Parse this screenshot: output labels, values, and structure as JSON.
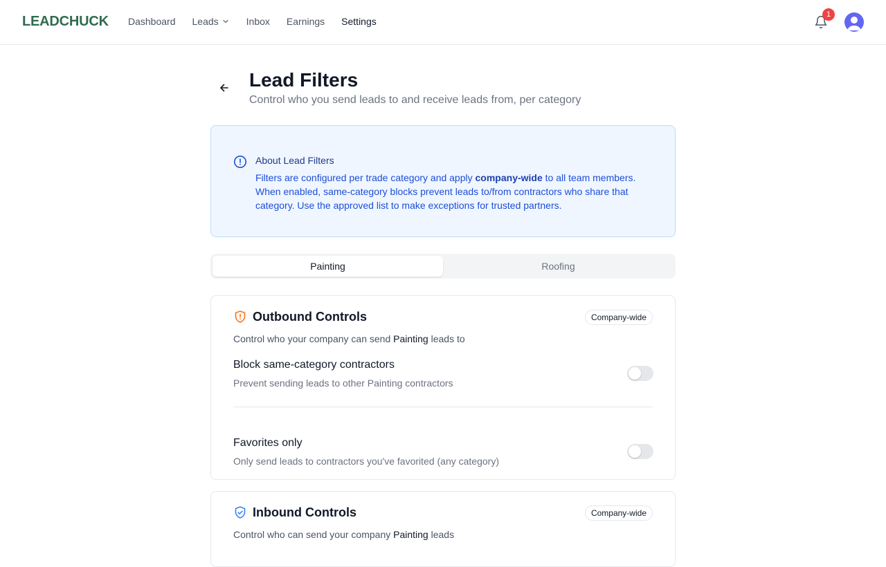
{
  "nav": {
    "logo": "LEADCHUCK",
    "links": [
      {
        "label": "Dashboard"
      },
      {
        "label": "Leads"
      },
      {
        "label": "Inbox"
      },
      {
        "label": "Earnings"
      },
      {
        "label": "Settings"
      }
    ],
    "notification_count": "1"
  },
  "header": {
    "title": "Lead Filters",
    "subtitle": "Control who you send leads to and receive leads from, per category"
  },
  "info": {
    "title": "About Lead Filters",
    "body_before": "Filters are configured per trade category and apply ",
    "body_bold": "company-wide",
    "body_after": " to all team members. When enabled, same-category blocks prevent leads to/from contractors who share that category. Use the approved list to make exceptions for trusted partners."
  },
  "tabs": [
    {
      "label": "Painting",
      "active": true
    },
    {
      "label": "Roofing",
      "active": false
    }
  ],
  "outbound": {
    "title": "Outbound Controls",
    "badge": "Company-wide",
    "desc_before": "Control who your company can send ",
    "desc_bold": "Painting",
    "desc_after": " leads to",
    "settings": [
      {
        "title": "Block same-category contractors",
        "desc": "Prevent sending leads to other Painting contractors",
        "enabled": false
      },
      {
        "title": "Favorites only",
        "desc": "Only send leads to contractors you've favorited (any category)",
        "enabled": false
      }
    ]
  },
  "inbound": {
    "title": "Inbound Controls",
    "badge": "Company-wide",
    "desc_before": "Control who can send your company ",
    "desc_bold": "Painting",
    "desc_after": " leads"
  },
  "colors": {
    "brand": "#2f6b4f",
    "info_bg": "#eff6ff",
    "info_text": "#1d4ed8",
    "outbound_icon": "#f97316",
    "inbound_icon": "#3b82f6",
    "notification": "#ef4444",
    "avatar": "#6366f1"
  },
  "icons": {
    "nav": [
      "chevron-down-icon",
      "bell-icon",
      "user-icon"
    ],
    "header": "arrow-left-icon",
    "info": "info-circle-icon",
    "outbound": "shield-alert-icon",
    "inbound": "shield-check-icon"
  }
}
